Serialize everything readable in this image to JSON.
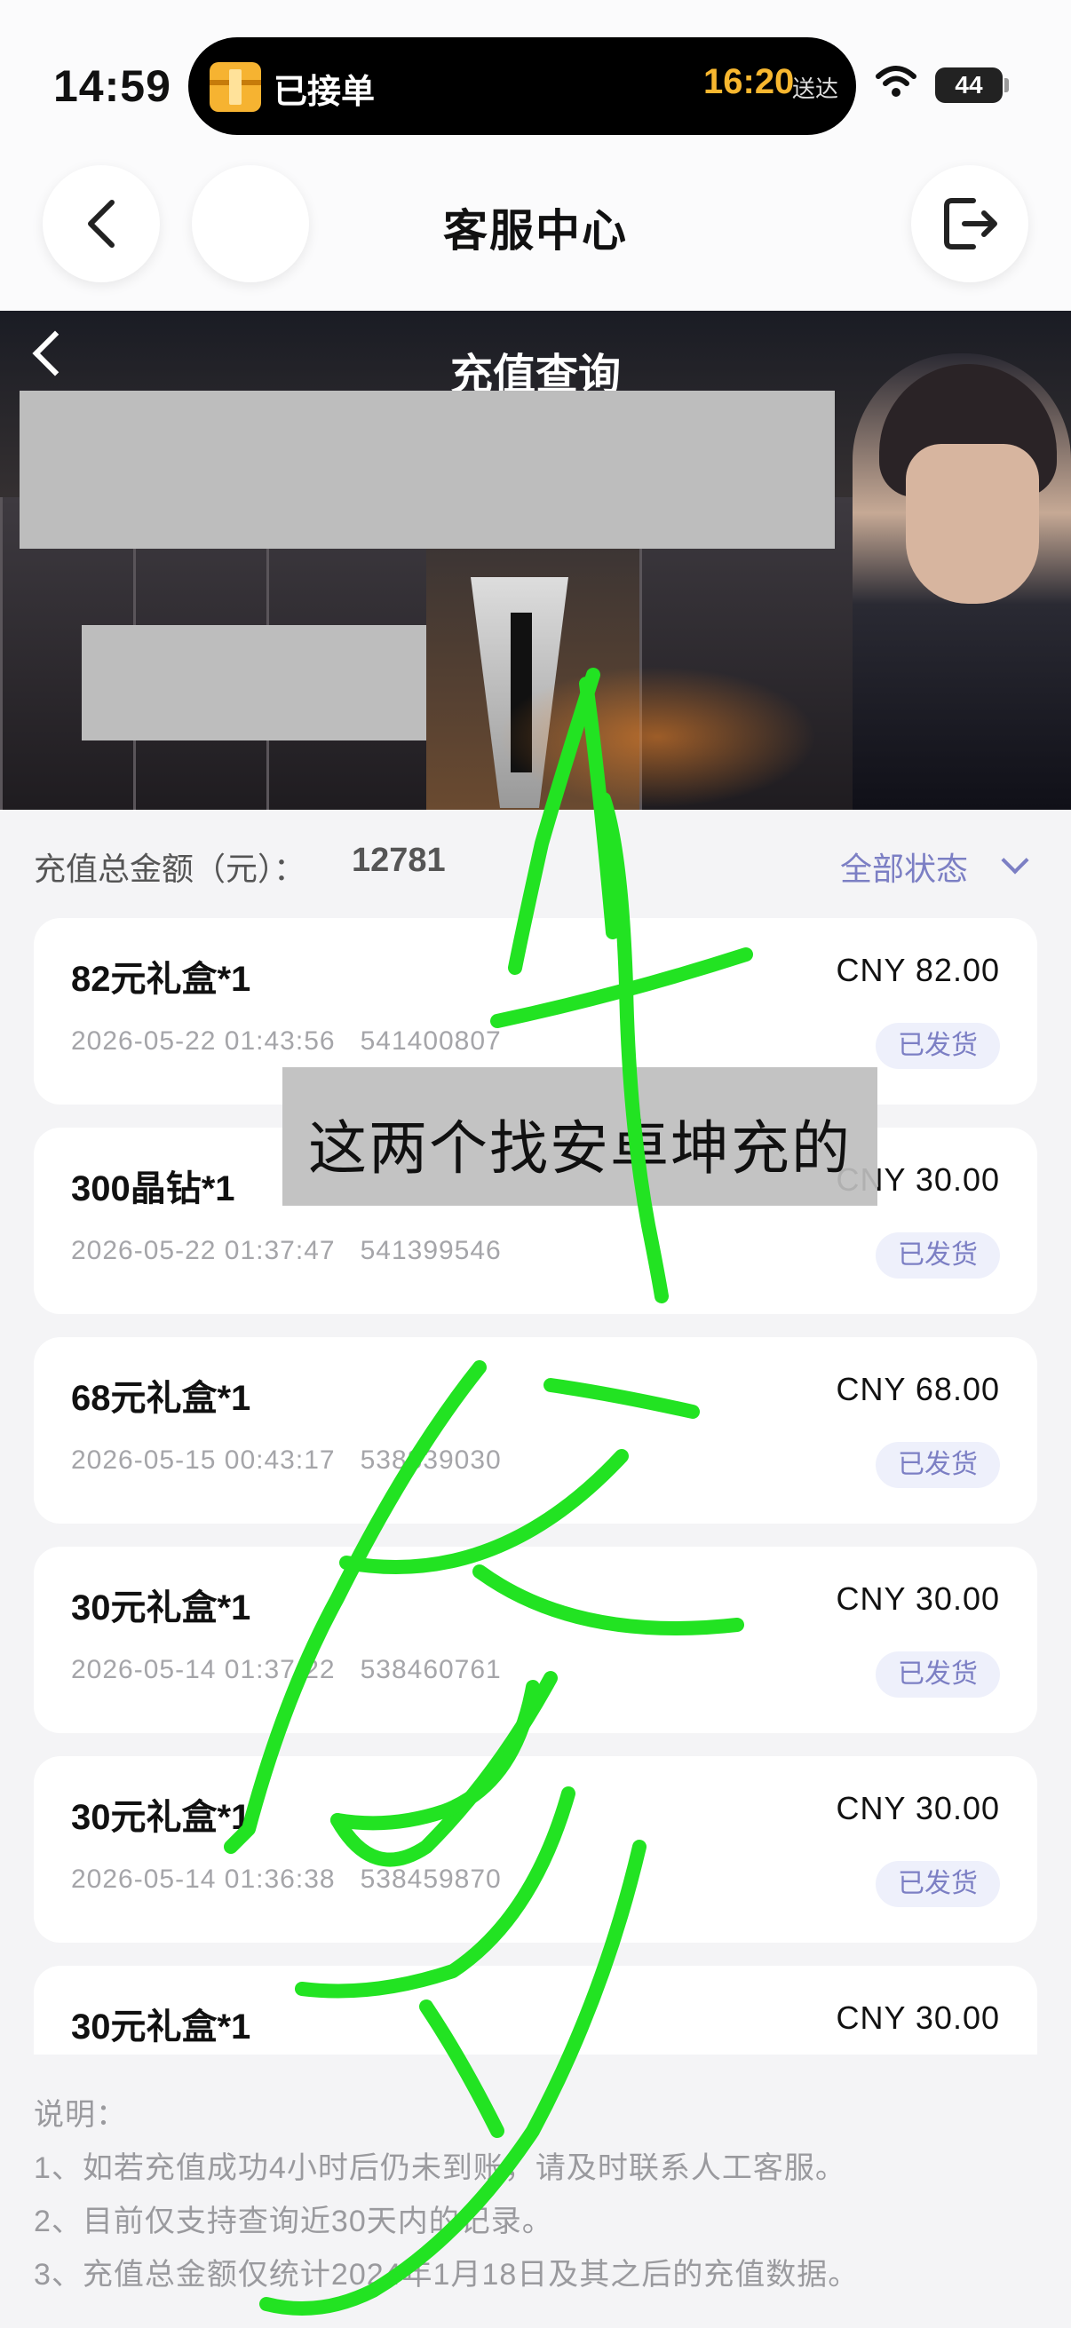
{
  "status_bar": {
    "time": "14:59",
    "island_label": "已接单",
    "island_time": "16:20",
    "island_suffix": "送达",
    "battery": "44"
  },
  "nav": {
    "title": "客服中心"
  },
  "banner": {
    "title": "充值查询"
  },
  "summary": {
    "label": "充值总金额（元）：",
    "value": "12781",
    "filter_label": "全部状态"
  },
  "orders": [
    {
      "title": "82元礼盒*1",
      "amount": "CNY  82.00",
      "meta": "2026-05-22 01:43:56   541400807",
      "status": "已发货"
    },
    {
      "title": "300晶钻*1",
      "amount": "CNY  30.00",
      "meta": "2026-05-22 01:37:47   541399546",
      "status": "已发货"
    },
    {
      "title": "68元礼盒*1",
      "amount": "CNY  68.00",
      "meta": "2026-05-15 00:43:17   538839030",
      "status": "已发货"
    },
    {
      "title": "30元礼盒*1",
      "amount": "CNY  30.00",
      "meta": "2026-05-14 01:37:22   538460761",
      "status": "已发货"
    },
    {
      "title": "30元礼盒*1",
      "amount": "CNY  30.00",
      "meta": "2026-05-14 01:36:38   538459870",
      "status": "已发货"
    },
    {
      "title": "30元礼盒*1",
      "amount": "CNY  30.00",
      "meta": "",
      "status": ""
    }
  ],
  "notes": {
    "heading": "说明：",
    "line1": "1、如若充值成功4小时后仍未到账，请及时联系人工客服。",
    "line2": "2、目前仅支持查询近30天内的记录。",
    "line3": "3、充值总金额仅统计2024年1月18日及其之后的充值数据。"
  },
  "overlay": {
    "caption": "这两个找安卓坤充的",
    "scribble_color": "#22e322"
  }
}
